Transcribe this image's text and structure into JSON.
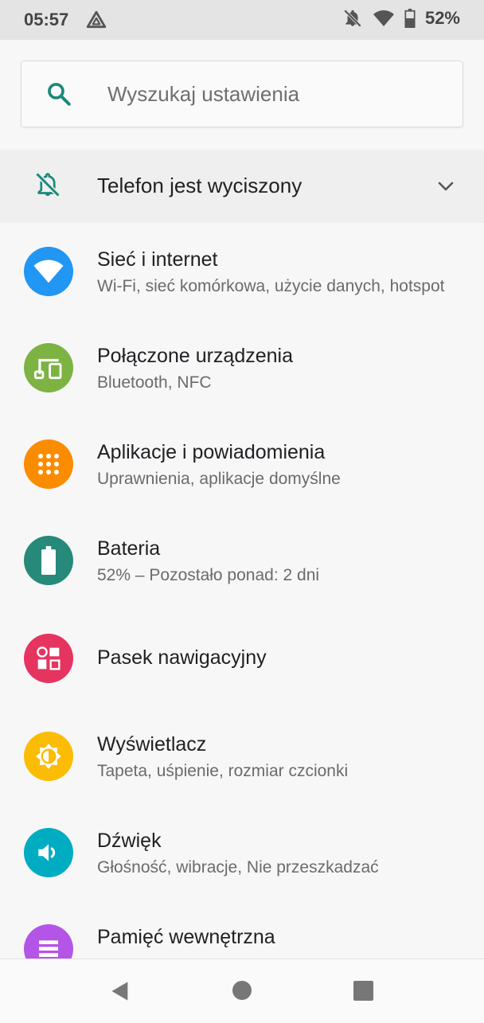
{
  "status_bar": {
    "time": "05:57",
    "battery_percent": "52%",
    "icons": [
      "app-notification-icon",
      "bell-off-icon",
      "wifi-icon",
      "battery-icon"
    ]
  },
  "search": {
    "placeholder": "Wyszukaj ustawienia",
    "icon": "search-icon"
  },
  "silent_banner": {
    "text": "Telefon jest wyciszony",
    "icon": "bell-off-icon",
    "chevron": "chevron-down-icon"
  },
  "settings": [
    {
      "title": "Sieć i internet",
      "subtitle": "Wi-Fi, sieć komórkowa, użycie danych, hotspot",
      "icon": "wifi-icon",
      "color": "#2196f3"
    },
    {
      "title": "Połączone urządzenia",
      "subtitle": "Bluetooth, NFC",
      "icon": "devices-icon",
      "color": "#7cb342"
    },
    {
      "title": "Aplikacje i powiadomienia",
      "subtitle": "Uprawnienia, aplikacje domyślne",
      "icon": "apps-grid-icon",
      "color": "#fb8c00"
    },
    {
      "title": "Bateria",
      "subtitle": "52% – Pozostało ponad: 2 dni",
      "icon": "battery-icon",
      "color": "#26897a"
    },
    {
      "title": "Pasek nawigacyjny",
      "subtitle": "",
      "icon": "navigation-bar-icon",
      "color": "#e63461"
    },
    {
      "title": "Wyświetlacz",
      "subtitle": "Tapeta, uśpienie, rozmiar czcionki",
      "icon": "brightness-icon",
      "color": "#fbbc05"
    },
    {
      "title": "Dźwięk",
      "subtitle": "Głośność, wibracje, Nie przeszkadzać",
      "icon": "volume-icon",
      "color": "#00acc1"
    },
    {
      "title": "Pamięć wewnętrzna",
      "subtitle": "",
      "icon": "storage-icon",
      "color": "#b455e8"
    }
  ],
  "nav_bar": {
    "back": "back-icon",
    "home": "home-icon",
    "recents": "recents-icon"
  }
}
